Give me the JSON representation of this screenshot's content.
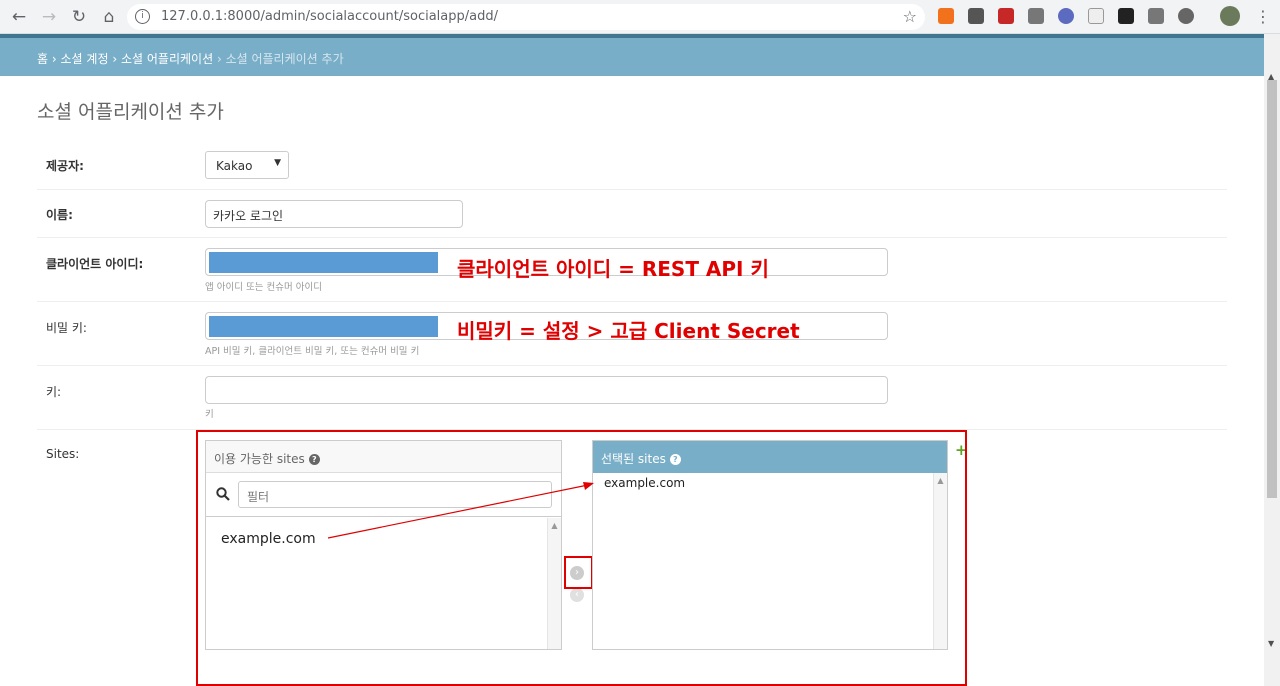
{
  "browser": {
    "url": "127.0.0.1:8000/admin/socialaccount/socialapp/add/"
  },
  "breadcrumbs": {
    "home": "홈",
    "app": "소셜 계정",
    "model": "소셜 어플리케이션",
    "current": "소셜 어플리케이션 추가",
    "sep": "›"
  },
  "page_title": "소셜 어플리케이션 추가",
  "form": {
    "provider": {
      "label": "제공자:",
      "value": "Kakao"
    },
    "name": {
      "label": "이름:",
      "value": "카카오 로그인"
    },
    "client_id": {
      "label": "클라이언트 아이디:",
      "help": "앱 아이디 또는 컨슈머 아이디"
    },
    "secret": {
      "label": "비밀 키:",
      "help": "API 비밀 키, 클라이언트 비밀 키, 또는 컨슈머 비밀 키"
    },
    "key": {
      "label": "키:",
      "help": "키"
    },
    "sites": {
      "label": "Sites:",
      "available_title": "이용 가능한 sites",
      "filter_placeholder": "필터",
      "available_items": [
        "example.com"
      ],
      "chosen_title": "선택된 sites",
      "chosen_items": [
        "example.com"
      ],
      "add_icon": "+"
    }
  },
  "annotations": {
    "client_id": "클라이언트 아이디 = REST API 키",
    "secret": "비밀키 = 설정 > 고급 Client Secret"
  },
  "colors": {
    "header": "#79aec8",
    "redact": "#5b9bd5",
    "annotation": "#e00000"
  }
}
